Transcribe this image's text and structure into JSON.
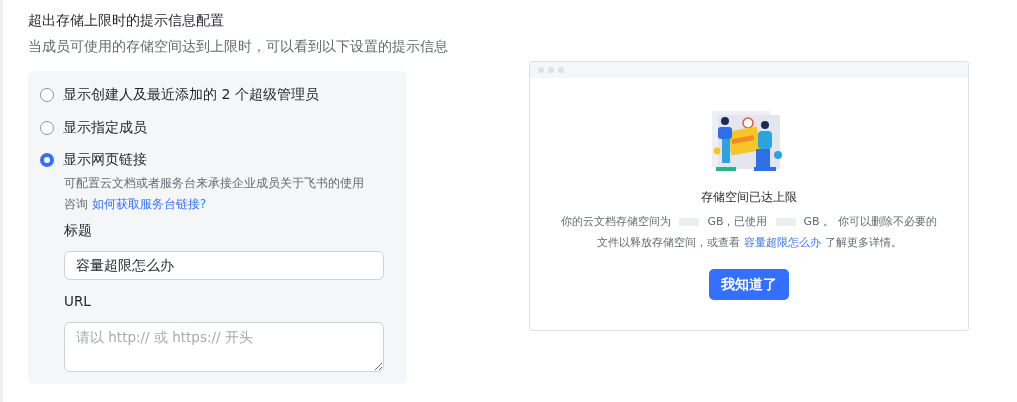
{
  "section": {
    "title": "超出存储上限时的提示信息配置",
    "subtitle": "当成员可使用的存储空间达到上限时，可以看到以下设置的提示信息"
  },
  "options": [
    {
      "label": "显示创建人及最近添加的 2 个超级管理员",
      "selected": false
    },
    {
      "label": "显示指定成员",
      "selected": false
    },
    {
      "label": "显示网页链接",
      "selected": true
    }
  ],
  "help": {
    "text": "可配置云文档或者服务台来承接企业成员关于飞书的使用咨询",
    "link": "如何获取服务台链接?"
  },
  "fields": [
    {
      "label": "标题",
      "kind": "input",
      "value": "容量超限怎么办"
    },
    {
      "label": "URL",
      "kind": "textarea",
      "placeholder": "请以 http:// 或 https:// 开头"
    }
  ],
  "preview": {
    "heading": "存储空间已达上限",
    "message": [
      {
        "kind": "text",
        "text": "你的云文档存储空间为"
      },
      {
        "kind": "blank"
      },
      {
        "kind": "text",
        "text": "GB，已使用"
      },
      {
        "kind": "blank"
      },
      {
        "kind": "text",
        "text": "GB 。 你可以删除不必要的文件以释放存储空间，或查看"
      },
      {
        "kind": "link",
        "text": "容量超限怎么办"
      },
      {
        "kind": "text",
        "text": "了解更多详情。"
      }
    ],
    "button": "我知道了"
  }
}
